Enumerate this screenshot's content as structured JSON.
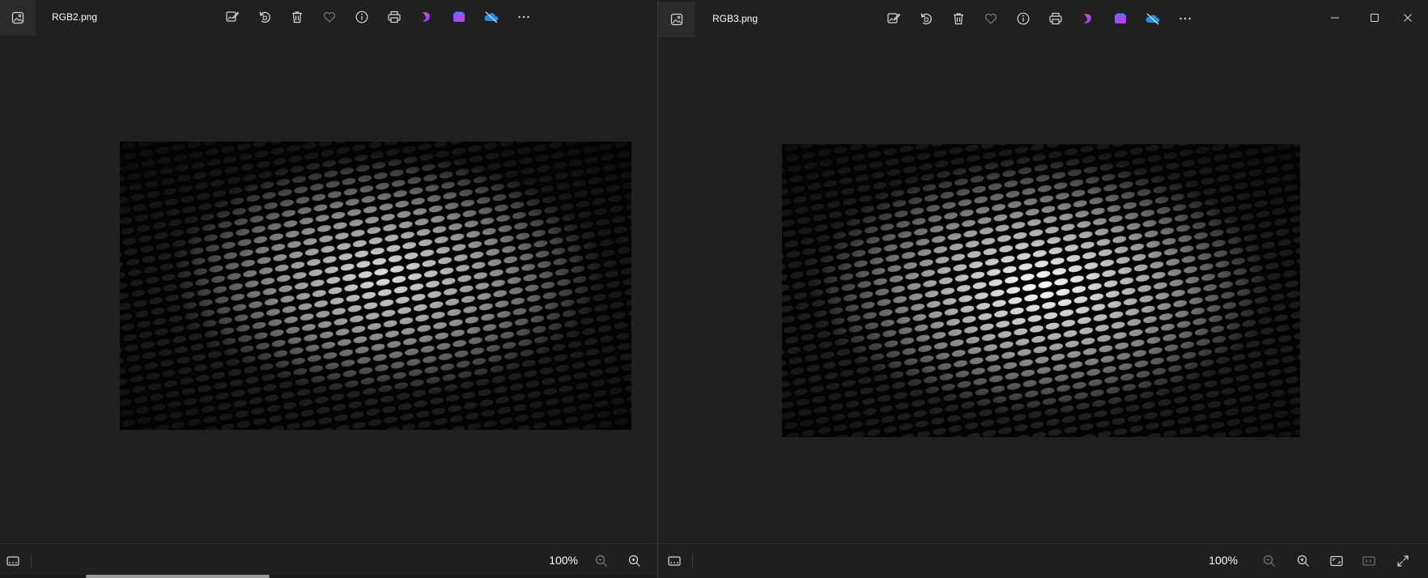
{
  "windows": [
    {
      "id": "left",
      "filename": "RGB2.png",
      "zoom_level": "100%",
      "toolbar_icons": [
        "edit-image-icon",
        "rotate-icon",
        "delete-icon",
        "favorite-icon",
        "info-icon",
        "print-icon",
        "clipchamp-icon",
        "designer-icon",
        "onedrive-offline-icon",
        "more-options-icon"
      ],
      "status_icons": [
        "filmstrip-icon",
        "zoom-out-icon",
        "zoom-in-icon"
      ],
      "horizontal_scroll_fraction": 0.28
    },
    {
      "id": "right",
      "filename": "RGB3.png",
      "zoom_level": "100%",
      "toolbar_icons": [
        "edit-image-icon",
        "rotate-icon",
        "delete-icon",
        "favorite-icon",
        "info-icon",
        "print-icon",
        "clipchamp-icon",
        "designer-icon",
        "onedrive-offline-icon",
        "more-options-icon"
      ],
      "caption_icons": [
        "minimize-icon",
        "maximize-icon",
        "close-icon"
      ],
      "status_icons": [
        "filmstrip-icon",
        "zoom-out-icon",
        "zoom-in-icon",
        "fit-to-window-icon",
        "actual-size-icon",
        "fullscreen-icon"
      ]
    }
  ],
  "colors": {
    "background": "#202020",
    "statusbar": "#1f1f1f",
    "icon": "#d6d6d6",
    "disabled_icon": "#7a7a7a"
  }
}
